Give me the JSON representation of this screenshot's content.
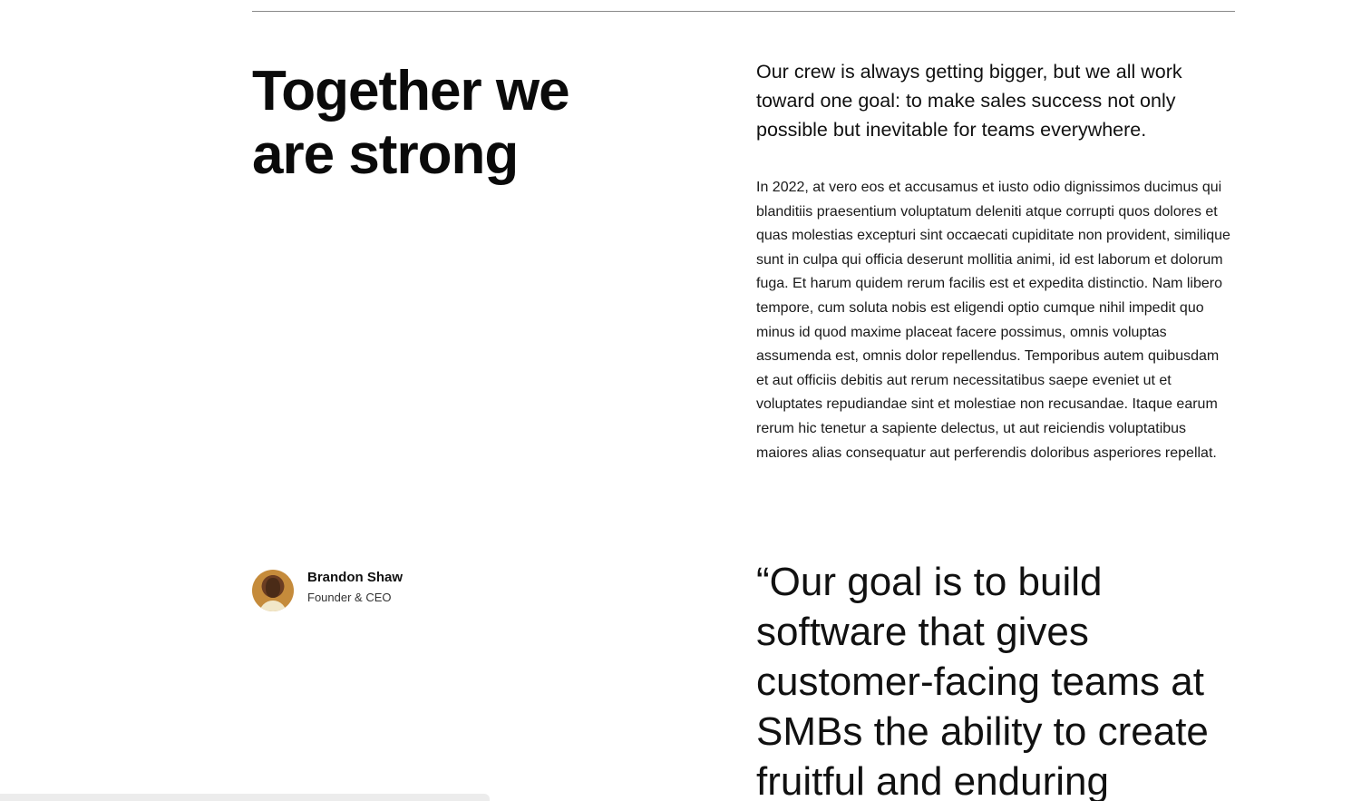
{
  "section": {
    "headline": "Together we are strong",
    "lead": "Our crew is always getting bigger, but we all work toward one goal: to make sales success not only possible but inevitable for teams everywhere.",
    "body": "In 2022, at vero eos et accusamus et iusto odio dignissimos ducimus qui blanditiis praesentium voluptatum deleniti atque corrupti quos dolores et quas molestias excepturi sint occaecati cupiditate non provident, similique sunt in culpa qui officia deserunt mollitia animi, id est laborum et dolorum fuga. Et harum quidem rerum facilis est et expedita distinctio. Nam libero tempore, cum soluta nobis est eligendi optio cumque nihil impedit quo minus id quod maxime placeat facere possimus, omnis voluptas assumenda est, omnis dolor repellendus. Temporibus autem quibusdam et aut officiis debitis aut rerum necessitatibus saepe eveniet ut et voluptates repudiandae sint et molestiae non recusandae. Itaque earum rerum hic tenetur a sapiente delectus, ut aut reiciendis voluptatibus maiores alias consequatur aut perferendis doloribus asperiores repellat."
  },
  "author": {
    "name": "Brandon Shaw",
    "role": "Founder & CEO",
    "avatar_icon": "avatar-photo"
  },
  "quote": {
    "text": "“Our goal is to build software that gives customer-facing teams at SMBs the ability to create fruitful and enduring"
  }
}
